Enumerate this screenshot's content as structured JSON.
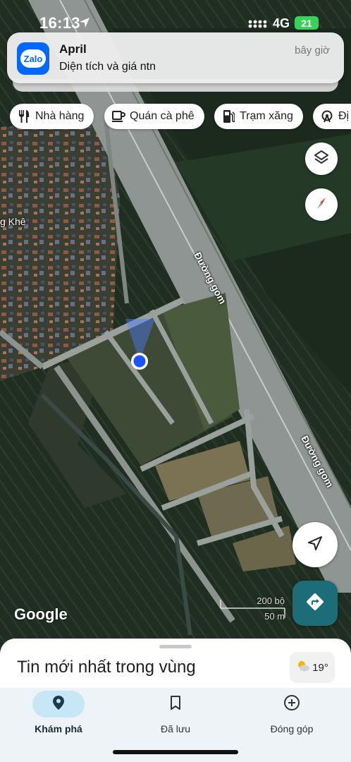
{
  "status_bar": {
    "time": "16:13",
    "network": "4G",
    "battery": "21"
  },
  "notification": {
    "app_icon_text": "Zalo",
    "app": "April",
    "message": "Diện tích và giá ntn",
    "time": "bây giờ"
  },
  "chips": [
    {
      "label": "Nhà hàng",
      "icon": "restaurant-icon"
    },
    {
      "label": "Quán cà phê",
      "icon": "coffee-icon"
    },
    {
      "label": "Trạm xăng",
      "icon": "gas-station-icon"
    },
    {
      "label": "Đị",
      "icon": "attraction-icon"
    }
  ],
  "map": {
    "road_label_1": "Đường gom",
    "road_label_2": "Đường gom",
    "place_label": "g Khê",
    "attribution": "Google",
    "scale_feet": "200 bộ",
    "scale_meters": "50 m"
  },
  "bottom_sheet": {
    "title": "Tin mới nhất trong vùng",
    "temperature": "19°"
  },
  "nav": {
    "items": [
      {
        "label": "Khám phá",
        "icon": "explore-pin-icon",
        "active": true
      },
      {
        "label": "Đã lưu",
        "icon": "bookmark-icon",
        "active": false
      },
      {
        "label": "Đóng góp",
        "icon": "add-circle-icon",
        "active": false
      }
    ]
  },
  "colors": {
    "accent": "#1c6d77",
    "location_dot": "#1a56ff",
    "zalo": "#0068ff",
    "active_pill": "#c7e6f6"
  }
}
